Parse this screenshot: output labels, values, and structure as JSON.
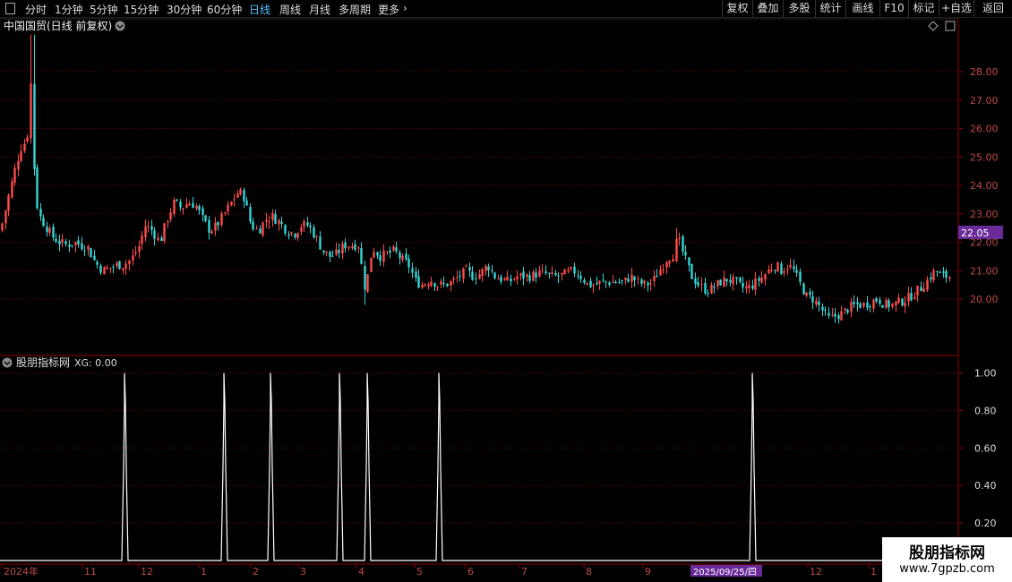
{
  "toolbar": {
    "periods": [
      {
        "label": "分时",
        "active": false
      },
      {
        "label": "1分钟",
        "active": false
      },
      {
        "label": "5分钟",
        "active": false
      },
      {
        "label": "15分钟",
        "active": false
      },
      {
        "label": "30分钟",
        "active": false
      },
      {
        "label": "60分钟",
        "active": false
      },
      {
        "label": "日线",
        "active": true
      },
      {
        "label": "周线",
        "active": false
      },
      {
        "label": "月线",
        "active": false
      },
      {
        "label": "多周期",
        "active": false
      },
      {
        "label": "更多",
        "active": false
      }
    ],
    "right_buttons": [
      "复权",
      "叠加",
      "多股",
      "统计",
      "画线",
      "F10",
      "标记",
      "+自选",
      "返回"
    ]
  },
  "main_panel": {
    "title": "中国国贸(日线 前复权)",
    "price_tag": "22.05",
    "y_ticks": [
      "28.00",
      "27.00",
      "26.00",
      "25.00",
      "24.00",
      "23.00",
      "22.00",
      "21.00",
      "20.00"
    ]
  },
  "indicator_panel": {
    "title": "股朋指标网",
    "xg_label": "XG: 0.00",
    "y_ticks": [
      "1.00",
      "0.80",
      "0.60",
      "0.40",
      "0.20"
    ]
  },
  "x_axis": {
    "labels": [
      "2024年",
      "11",
      "12",
      "1",
      "2",
      "3",
      "4",
      "5",
      "6",
      "7",
      "8",
      "9",
      "2025/09/25/四",
      "12",
      "1"
    ]
  },
  "watermark": {
    "line1": "股朋指标网",
    "line2": "www.7gpzb.com"
  },
  "colors": {
    "up": "#ff4a4a",
    "down": "#34d6d6",
    "signal": "#ffffff",
    "grid": "#5a0000",
    "tag_bg": "#6a2a9a"
  },
  "chart_data": {
    "type": "candlestick",
    "title": "中国国贸(日线 前复权)",
    "ylim": [
      19.0,
      30.0
    ],
    "close_path": [
      [
        0,
        22.4
      ],
      [
        6,
        23.2
      ],
      [
        12,
        24.0
      ],
      [
        18,
        24.8
      ],
      [
        24,
        25.4
      ],
      [
        30,
        25.6
      ],
      [
        34,
        27.6
      ],
      [
        38,
        24.2
      ],
      [
        42,
        23.0
      ],
      [
        50,
        22.6
      ],
      [
        58,
        22.2
      ],
      [
        66,
        22.0
      ],
      [
        74,
        21.9
      ],
      [
        82,
        22.0
      ],
      [
        90,
        21.9
      ],
      [
        98,
        21.8
      ],
      [
        106,
        21.3
      ],
      [
        114,
        21.0
      ],
      [
        122,
        21.1
      ],
      [
        130,
        21.2
      ],
      [
        138,
        21.2
      ],
      [
        146,
        21.4
      ],
      [
        154,
        21.8
      ],
      [
        162,
        22.6
      ],
      [
        170,
        22.4
      ],
      [
        178,
        22.0
      ],
      [
        186,
        22.8
      ],
      [
        194,
        23.4
      ],
      [
        202,
        23.2
      ],
      [
        210,
        23.4
      ],
      [
        218,
        23.3
      ],
      [
        226,
        22.8
      ],
      [
        234,
        22.4
      ],
      [
        242,
        22.6
      ],
      [
        250,
        23.0
      ],
      [
        258,
        23.4
      ],
      [
        266,
        23.8
      ],
      [
        272,
        23.6
      ],
      [
        280,
        22.6
      ],
      [
        288,
        22.4
      ],
      [
        296,
        22.8
      ],
      [
        304,
        22.9
      ],
      [
        312,
        22.7
      ],
      [
        320,
        22.4
      ],
      [
        328,
        22.3
      ],
      [
        336,
        22.6
      ],
      [
        344,
        22.6
      ],
      [
        352,
        22.2
      ],
      [
        360,
        21.7
      ],
      [
        368,
        21.5
      ],
      [
        376,
        21.6
      ],
      [
        384,
        21.9
      ],
      [
        392,
        21.9
      ],
      [
        400,
        21.9
      ],
      [
        404,
        21.0
      ],
      [
        408,
        20.2
      ],
      [
        412,
        21.3
      ],
      [
        416,
        21.8
      ],
      [
        424,
        21.5
      ],
      [
        432,
        21.6
      ],
      [
        440,
        21.7
      ],
      [
        448,
        21.4
      ],
      [
        456,
        21.2
      ],
      [
        464,
        20.6
      ],
      [
        472,
        20.5
      ],
      [
        480,
        20.7
      ],
      [
        488,
        20.5
      ],
      [
        496,
        20.5
      ],
      [
        504,
        20.6
      ],
      [
        512,
        20.8
      ],
      [
        520,
        21.0
      ],
      [
        528,
        20.8
      ],
      [
        536,
        20.9
      ],
      [
        544,
        21.2
      ],
      [
        552,
        20.8
      ],
      [
        560,
        20.7
      ],
      [
        568,
        20.6
      ],
      [
        576,
        20.8
      ],
      [
        584,
        20.8
      ],
      [
        592,
        20.8
      ],
      [
        600,
        20.9
      ],
      [
        608,
        20.9
      ],
      [
        616,
        20.8
      ],
      [
        624,
        20.8
      ],
      [
        632,
        20.9
      ],
      [
        640,
        21.0
      ],
      [
        648,
        20.8
      ],
      [
        656,
        20.5
      ],
      [
        664,
        20.5
      ],
      [
        672,
        20.6
      ],
      [
        680,
        20.6
      ],
      [
        688,
        20.6
      ],
      [
        696,
        20.6
      ],
      [
        704,
        20.8
      ],
      [
        712,
        20.6
      ],
      [
        720,
        20.5
      ],
      [
        728,
        20.6
      ],
      [
        736,
        21.0
      ],
      [
        744,
        21.4
      ],
      [
        752,
        21.6
      ],
      [
        756,
        22.2
      ],
      [
        760,
        21.8
      ],
      [
        766,
        21.3
      ],
      [
        772,
        20.8
      ],
      [
        780,
        20.5
      ],
      [
        788,
        20.3
      ],
      [
        796,
        20.4
      ],
      [
        804,
        20.6
      ],
      [
        812,
        20.7
      ],
      [
        820,
        20.6
      ],
      [
        828,
        20.4
      ],
      [
        836,
        20.4
      ],
      [
        844,
        20.6
      ],
      [
        852,
        20.8
      ],
      [
        860,
        21.1
      ],
      [
        866,
        21.2
      ],
      [
        872,
        21.0
      ],
      [
        880,
        21.2
      ],
      [
        886,
        21.0
      ],
      [
        892,
        20.6
      ],
      [
        900,
        20.1
      ],
      [
        908,
        20.0
      ],
      [
        916,
        19.7
      ],
      [
        924,
        19.3
      ],
      [
        932,
        19.4
      ],
      [
        940,
        19.5
      ],
      [
        948,
        19.7
      ],
      [
        956,
        19.8
      ],
      [
        964,
        19.8
      ],
      [
        972,
        19.9
      ],
      [
        980,
        20.0
      ],
      [
        988,
        19.8
      ],
      [
        996,
        19.8
      ],
      [
        1004,
        19.9
      ],
      [
        1012,
        20.0
      ],
      [
        1020,
        20.2
      ],
      [
        1028,
        20.4
      ],
      [
        1036,
        20.7
      ],
      [
        1044,
        21.0
      ],
      [
        1052,
        20.8
      ],
      [
        1060,
        20.8
      ]
    ],
    "indicator": {
      "series": [
        {
          "name": "XG",
          "values": [
            0,
            1,
            0,
            1,
            0,
            1,
            0,
            1,
            0,
            1,
            0,
            1,
            0,
            1,
            0
          ]
        }
      ],
      "signal_dates_approx": [
        "2024年12月",
        "2025年1月",
        "2025年2月",
        "2025年3月",
        "2025年4月初",
        "2025年5月",
        "2025/09/25"
      ],
      "ylim": [
        0,
        1.0
      ]
    }
  }
}
